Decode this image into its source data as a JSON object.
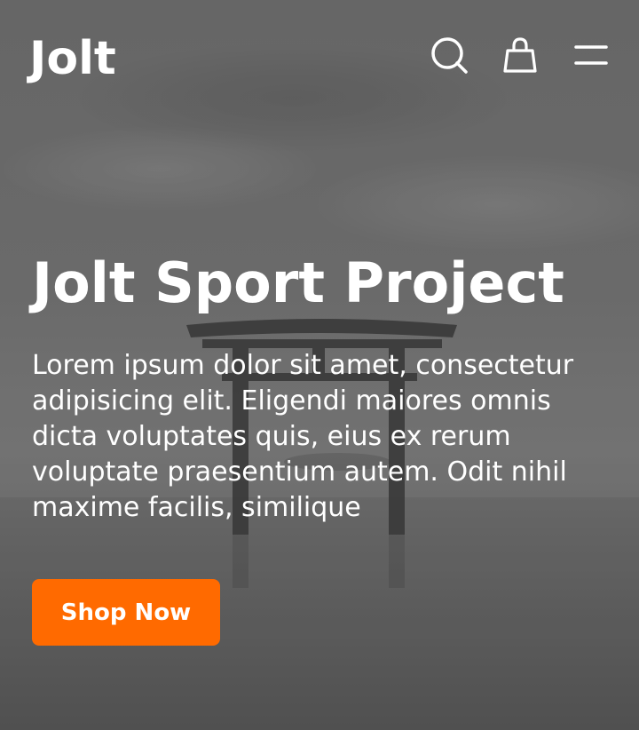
{
  "header": {
    "logo_text": "Jolt",
    "icons": [
      "search-icon",
      "shopping-bag-icon",
      "menu-icon"
    ]
  },
  "hero": {
    "title": "Jolt Sport Project",
    "description": "Lorem ipsum dolor sit amet, consectetur adipisicing elit. Eligendi maiores omnis dicta voluptates quis, eius ex rerum voluptate praesentium autem. Odit nihil maxime facilis, similique",
    "cta_label": "Shop Now"
  },
  "colors": {
    "accent": "#ff6a00",
    "text": "#ffffff"
  }
}
